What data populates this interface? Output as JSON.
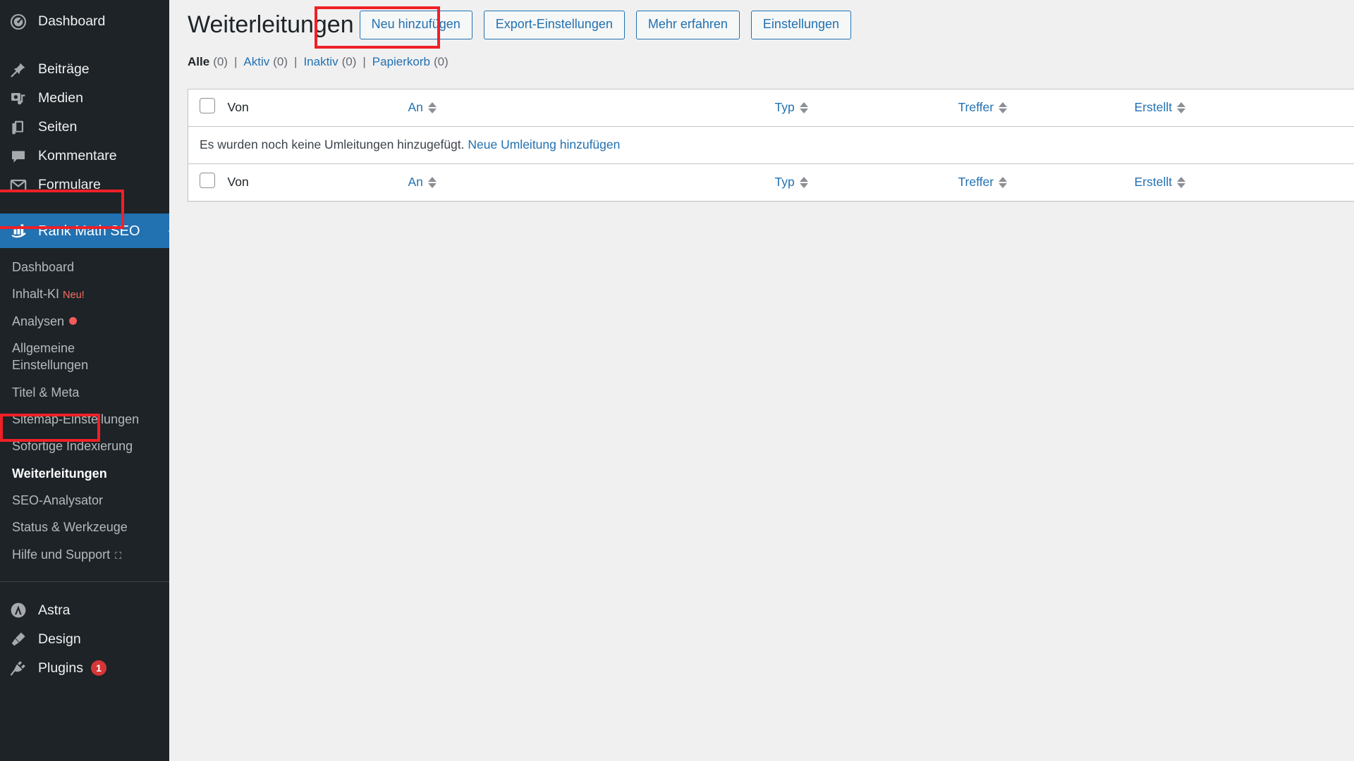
{
  "colors": {
    "sidebar_bg": "#1d2327",
    "accent_blue": "#2271b1",
    "annotation_red": "#f02027",
    "badge_red": "#d63638",
    "content_bg": "#f0f0f1"
  },
  "sidebar": {
    "top_items": [
      {
        "label": "Dashboard",
        "icon": "dashboard-icon"
      },
      {
        "label": "Beiträge",
        "icon": "pin-icon"
      },
      {
        "label": "Medien",
        "icon": "media-icon"
      },
      {
        "label": "Seiten",
        "icon": "pages-icon"
      },
      {
        "label": "Kommentare",
        "icon": "comments-icon"
      },
      {
        "label": "Formulare",
        "icon": "envelope-icon"
      }
    ],
    "current_item": {
      "label": "Rank Math SEO",
      "icon": "rank-math-icon",
      "highlighted": true
    },
    "submenu": [
      {
        "label": "Dashboard"
      },
      {
        "label": "Inhalt-KI",
        "badge": "Neu!"
      },
      {
        "label": "Analysen",
        "dot": "red-dot"
      },
      {
        "label": "Allgemeine Einstellungen"
      },
      {
        "label": "Titel & Meta"
      },
      {
        "label": "Sitemap-Einstellungen"
      },
      {
        "label": "Sofortige Indexierung"
      },
      {
        "label": "Weiterleitungen",
        "current": true,
        "highlighted": true
      },
      {
        "label": "SEO-Analysator"
      },
      {
        "label": "Status & Werkzeuge"
      },
      {
        "label": "Hilfe und Support",
        "external": true
      }
    ],
    "bottom_items": [
      {
        "label": "Astra",
        "icon": "astra-logo-icon"
      },
      {
        "label": "Design",
        "icon": "paintbrush-icon"
      },
      {
        "label": "Plugins",
        "icon": "plug-icon",
        "count": "1"
      }
    ]
  },
  "page": {
    "title": "Weiterleitungen",
    "buttons": [
      {
        "label": "Neu hinzufügen",
        "highlighted": true
      },
      {
        "label": "Export-Einstellungen"
      },
      {
        "label": "Mehr erfahren"
      },
      {
        "label": "Einstellungen"
      }
    ],
    "filters": [
      {
        "label": "Alle",
        "count": "(0)",
        "current": true
      },
      {
        "label": "Aktiv",
        "count": "(0)"
      },
      {
        "label": "Inaktiv",
        "count": "(0)"
      },
      {
        "label": "Papierkorb",
        "count": "(0)"
      }
    ],
    "filter_separator": "|",
    "table": {
      "columns": [
        {
          "key": "from",
          "label": "Von",
          "sortable": false
        },
        {
          "key": "to",
          "label": "An",
          "sortable": true
        },
        {
          "key": "type",
          "label": "Typ",
          "sortable": true
        },
        {
          "key": "hits",
          "label": "Treffer",
          "sortable": true
        },
        {
          "key": "created",
          "label": "Erstellt",
          "sortable": true
        }
      ],
      "rows": [],
      "empty_message": "Es wurden noch keine Umleitungen hinzugefügt.",
      "empty_link": "Neue Umleitung hinzufügen"
    }
  }
}
